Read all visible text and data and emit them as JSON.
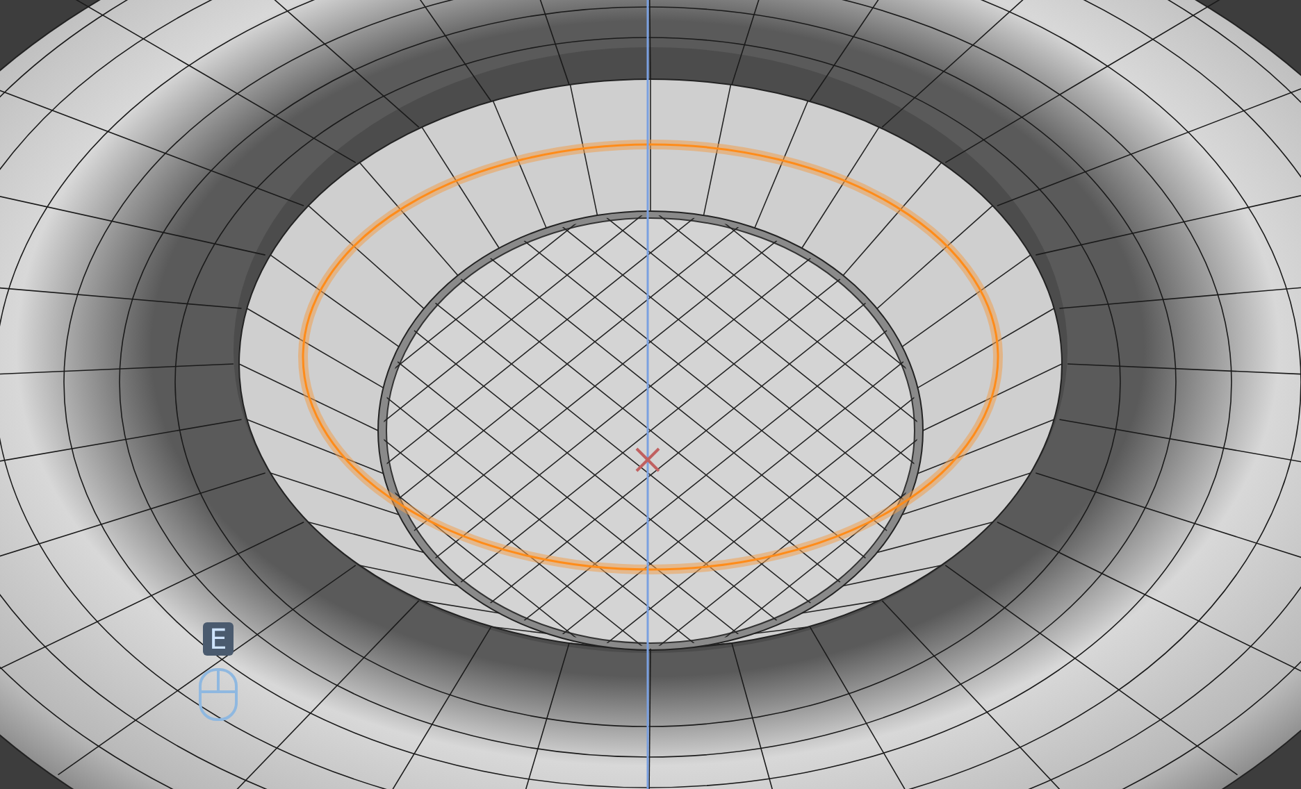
{
  "viewport": {
    "screencast_key": "E"
  }
}
